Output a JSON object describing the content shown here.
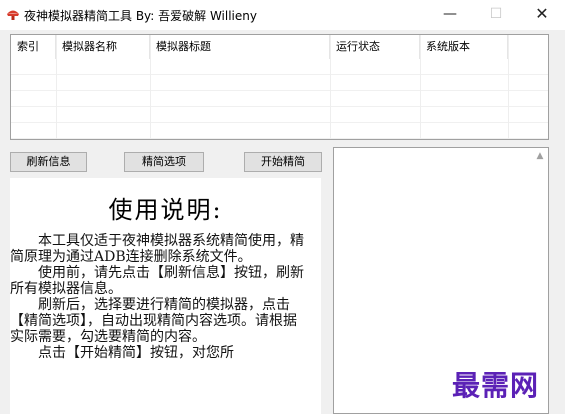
{
  "window": {
    "title": "夜神模拟器精简工具 By: 吾爱破解 Willieny",
    "minimize": "—",
    "maximize": "☐",
    "close": "✕"
  },
  "table": {
    "columns": [
      "索引",
      "模拟器名称",
      "模拟器标题",
      "运行状态",
      "系统版本"
    ],
    "rows": []
  },
  "buttons": {
    "refresh": "刷新信息",
    "options": "精简选项",
    "start": "开始精简"
  },
  "instructions": {
    "title": "使用说明:",
    "paragraphs": [
      "本工具仅适于夜神模拟器系统精简使用，精简原理为通过ADB连接删除系统文件。",
      "使用前，请先点击【刷新信息】按钮，刷新所有模拟器信息。",
      "刷新后，选择要进行精简的模拟器，点击【精简选项】，自动出现精简内容选项。请根据实际需要，勾选要精简的内容。",
      "点击【开始精简】按钮，对您所"
    ]
  },
  "log": {
    "scroll_up_icon": "▲"
  },
  "watermark": "最需网"
}
